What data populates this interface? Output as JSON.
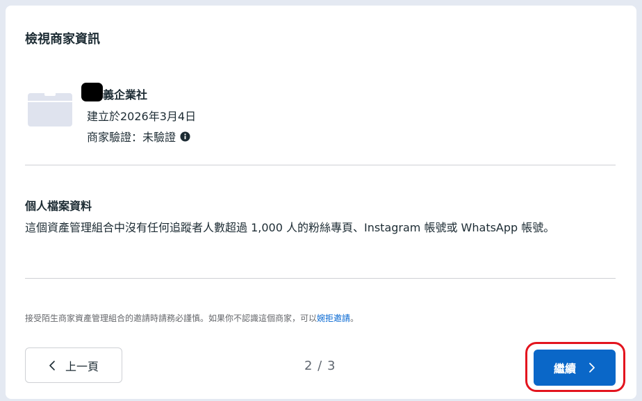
{
  "card": {
    "title": "檢視商家資訊"
  },
  "business": {
    "name": "義企業社",
    "created": "建立於2026年3月4日",
    "verification": "商家驗證：未驗證"
  },
  "profile": {
    "title": "個人檔案資料",
    "body": "這個資產管理組合中沒有任何追蹤者人數超過 1,000 人的粉絲專頁、Instagram 帳號或 WhatsApp 帳號。"
  },
  "notice": {
    "text": "接受陌生商家資產管理組合的邀請時請務必謹慎。如果你不認識這個商家，可以",
    "link": "婉拒邀請",
    "end": "。"
  },
  "footer": {
    "prev_label": "上一頁",
    "pager": "2 / 3",
    "next_label": "繼續"
  },
  "icons": [
    "briefcase-icon",
    "info-icon",
    "chevron-left-icon",
    "chevron-right-icon"
  ],
  "colors": {
    "primary": "#0a67c8",
    "highlight": "#e3141e",
    "link": "#0064d1"
  }
}
